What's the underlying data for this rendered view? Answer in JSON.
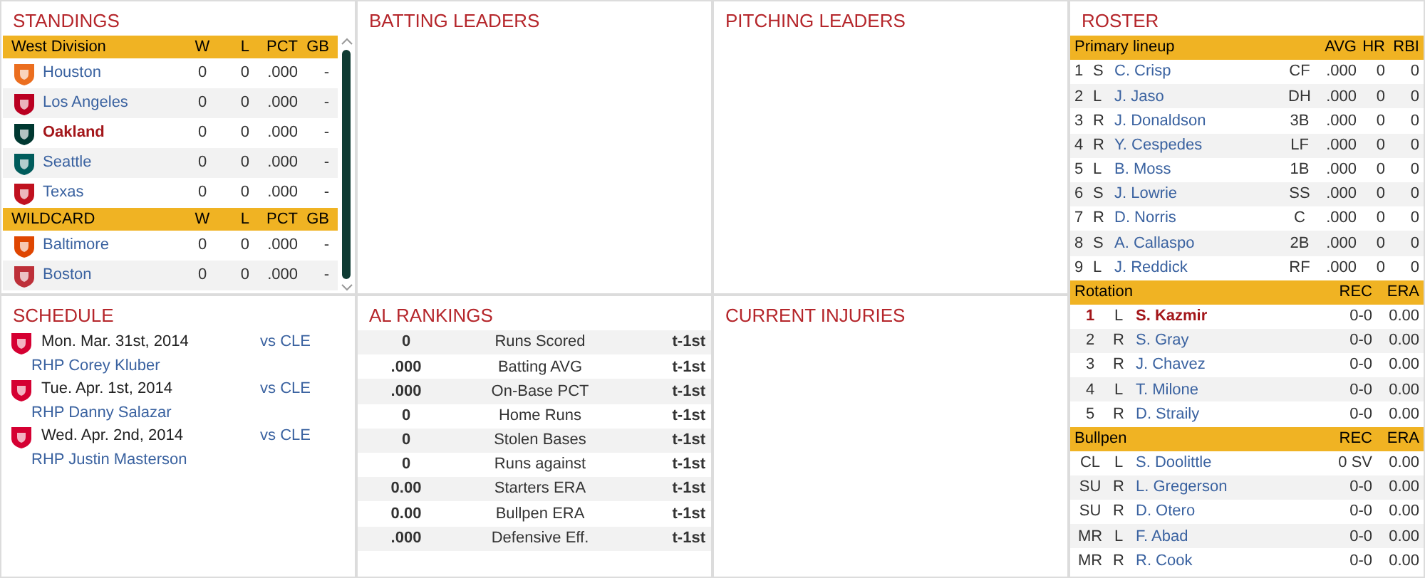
{
  "standings": {
    "title": "STANDINGS",
    "groups": [
      {
        "label": "West Division",
        "columns": [
          "W",
          "L",
          "PCT",
          "GB"
        ],
        "teams": [
          {
            "name": "Houston",
            "w": "0",
            "l": "0",
            "pct": ".000",
            "gb": "-",
            "color": "#eb6e1f",
            "current": false
          },
          {
            "name": "Los Angeles",
            "w": "0",
            "l": "0",
            "pct": ".000",
            "gb": "-",
            "color": "#ba0021",
            "current": false
          },
          {
            "name": "Oakland",
            "w": "0",
            "l": "0",
            "pct": ".000",
            "gb": "-",
            "color": "#003831",
            "current": true
          },
          {
            "name": "Seattle",
            "w": "0",
            "l": "0",
            "pct": ".000",
            "gb": "-",
            "color": "#005c5c",
            "current": false
          },
          {
            "name": "Texas",
            "w": "0",
            "l": "0",
            "pct": ".000",
            "gb": "-",
            "color": "#c0111f",
            "current": false
          }
        ]
      },
      {
        "label": "WILDCARD",
        "columns": [
          "W",
          "L",
          "PCT",
          "GB"
        ],
        "teams": [
          {
            "name": "Baltimore",
            "w": "0",
            "l": "0",
            "pct": ".000",
            "gb": "-",
            "color": "#df4601",
            "current": false
          },
          {
            "name": "Boston",
            "w": "0",
            "l": "0",
            "pct": ".000",
            "gb": "-",
            "color": "#bd3039",
            "current": false
          }
        ]
      }
    ]
  },
  "batting_leaders": {
    "title": "BATTING LEADERS"
  },
  "pitching_leaders": {
    "title": "PITCHING LEADERS"
  },
  "schedule": {
    "title": "SCHEDULE",
    "games": [
      {
        "date": "Mon. Mar. 31st, 2014",
        "opponent": "vs CLE",
        "pitcher": "RHP Corey Kluber",
        "color": "#d50032"
      },
      {
        "date": "Tue. Apr. 1st, 2014",
        "opponent": "vs CLE",
        "pitcher": "RHP Danny Salazar",
        "color": "#d50032"
      },
      {
        "date": "Wed. Apr. 2nd, 2014",
        "opponent": "vs CLE",
        "pitcher": "RHP Justin Masterson",
        "color": "#d50032"
      }
    ]
  },
  "rankings": {
    "title": "AL RANKINGS",
    "rows": [
      {
        "value": "0",
        "stat": "Runs Scored",
        "rank": "t-1st"
      },
      {
        "value": ".000",
        "stat": "Batting AVG",
        "rank": "t-1st"
      },
      {
        "value": ".000",
        "stat": "On-Base PCT",
        "rank": "t-1st"
      },
      {
        "value": "0",
        "stat": "Home Runs",
        "rank": "t-1st"
      },
      {
        "value": "0",
        "stat": "Stolen Bases",
        "rank": "t-1st"
      },
      {
        "value": "0",
        "stat": "Runs against",
        "rank": "t-1st"
      },
      {
        "value": "0.00",
        "stat": "Starters ERA",
        "rank": "t-1st"
      },
      {
        "value": "0.00",
        "stat": "Bullpen ERA",
        "rank": "t-1st"
      },
      {
        "value": ".000",
        "stat": "Defensive Eff.",
        "rank": "t-1st"
      }
    ]
  },
  "injuries": {
    "title": "CURRENT INJURIES"
  },
  "roster": {
    "title": "ROSTER",
    "lineup": {
      "label": "Primary lineup",
      "columns": [
        "AVG",
        "HR",
        "RBI"
      ],
      "players": [
        {
          "order": "1",
          "bats": "S",
          "name": "C. Crisp",
          "pos": "CF",
          "avg": ".000",
          "hr": "0",
          "rbi": "0"
        },
        {
          "order": "2",
          "bats": "L",
          "name": "J. Jaso",
          "pos": "DH",
          "avg": ".000",
          "hr": "0",
          "rbi": "0"
        },
        {
          "order": "3",
          "bats": "R",
          "name": "J. Donaldson",
          "pos": "3B",
          "avg": ".000",
          "hr": "0",
          "rbi": "0"
        },
        {
          "order": "4",
          "bats": "R",
          "name": "Y. Cespedes",
          "pos": "LF",
          "avg": ".000",
          "hr": "0",
          "rbi": "0"
        },
        {
          "order": "5",
          "bats": "L",
          "name": "B. Moss",
          "pos": "1B",
          "avg": ".000",
          "hr": "0",
          "rbi": "0"
        },
        {
          "order": "6",
          "bats": "S",
          "name": "J. Lowrie",
          "pos": "SS",
          "avg": ".000",
          "hr": "0",
          "rbi": "0"
        },
        {
          "order": "7",
          "bats": "R",
          "name": "D. Norris",
          "pos": "C",
          "avg": ".000",
          "hr": "0",
          "rbi": "0"
        },
        {
          "order": "8",
          "bats": "S",
          "name": "A. Callaspo",
          "pos": "2B",
          "avg": ".000",
          "hr": "0",
          "rbi": "0"
        },
        {
          "order": "9",
          "bats": "L",
          "name": "J. Reddick",
          "pos": "RF",
          "avg": ".000",
          "hr": "0",
          "rbi": "0"
        }
      ]
    },
    "rotation": {
      "label": "Rotation",
      "columns": [
        "REC",
        "ERA"
      ],
      "pitchers": [
        {
          "slot": "1",
          "throws": "L",
          "name": "S. Kazmir",
          "rec": "0-0",
          "era": "0.00",
          "current": true
        },
        {
          "slot": "2",
          "throws": "R",
          "name": "S. Gray",
          "rec": "0-0",
          "era": "0.00",
          "current": false
        },
        {
          "slot": "3",
          "throws": "R",
          "name": "J. Chavez",
          "rec": "0-0",
          "era": "0.00",
          "current": false
        },
        {
          "slot": "4",
          "throws": "L",
          "name": "T. Milone",
          "rec": "0-0",
          "era": "0.00",
          "current": false
        },
        {
          "slot": "5",
          "throws": "R",
          "name": "D. Straily",
          "rec": "0-0",
          "era": "0.00",
          "current": false
        }
      ]
    },
    "bullpen": {
      "label": "Bullpen",
      "columns": [
        "REC",
        "ERA"
      ],
      "pitchers": [
        {
          "slot": "CL",
          "throws": "L",
          "name": "S. Doolittle",
          "rec": "0 SV",
          "era": "0.00",
          "current": false
        },
        {
          "slot": "SU",
          "throws": "R",
          "name": "L. Gregerson",
          "rec": "0-0",
          "era": "0.00",
          "current": false
        },
        {
          "slot": "SU",
          "throws": "R",
          "name": "D. Otero",
          "rec": "0-0",
          "era": "0.00",
          "current": false
        },
        {
          "slot": "MR",
          "throws": "L",
          "name": "F. Abad",
          "rec": "0-0",
          "era": "0.00",
          "current": false
        },
        {
          "slot": "MR",
          "throws": "R",
          "name": "R. Cook",
          "rec": "0-0",
          "era": "0.00",
          "current": false
        }
      ]
    }
  }
}
